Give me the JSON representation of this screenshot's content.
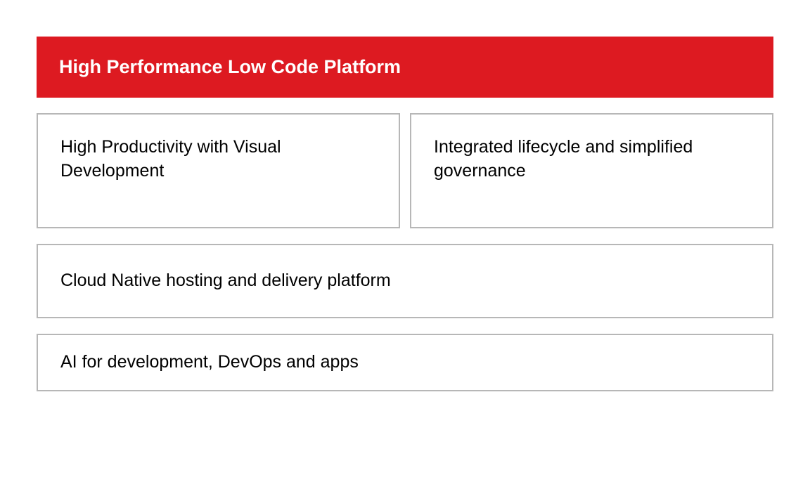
{
  "header": {
    "title": "High Performance Low Code Platform"
  },
  "boxes": {
    "top_left": "High Productivity with Visual Development",
    "top_right": "Integrated lifecycle and simplified governance",
    "middle": "Cloud Native hosting and delivery platform",
    "bottom": "AI for development, DevOps and apps"
  },
  "colors": {
    "header_bg": "#dd1a21",
    "border": "#b7b7b7"
  }
}
